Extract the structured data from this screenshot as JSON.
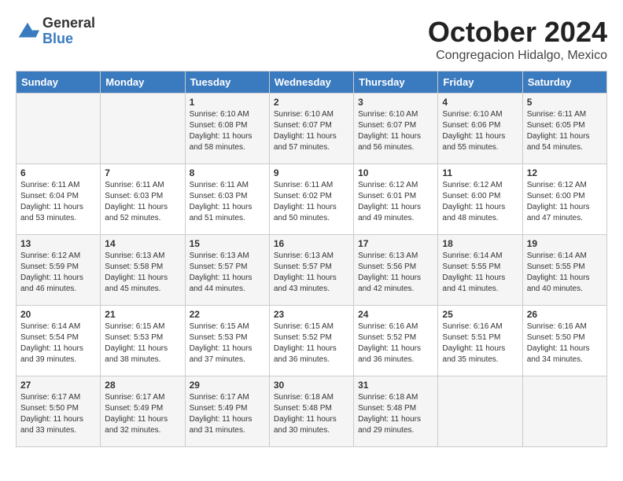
{
  "logo": {
    "general": "General",
    "blue": "Blue"
  },
  "title": "October 2024",
  "location": "Congregacion Hidalgo, Mexico",
  "headers": [
    "Sunday",
    "Monday",
    "Tuesday",
    "Wednesday",
    "Thursday",
    "Friday",
    "Saturday"
  ],
  "weeks": [
    [
      {
        "day": "",
        "sunrise": "",
        "sunset": "",
        "daylight": ""
      },
      {
        "day": "",
        "sunrise": "",
        "sunset": "",
        "daylight": ""
      },
      {
        "day": "1",
        "sunrise": "Sunrise: 6:10 AM",
        "sunset": "Sunset: 6:08 PM",
        "daylight": "Daylight: 11 hours and 58 minutes."
      },
      {
        "day": "2",
        "sunrise": "Sunrise: 6:10 AM",
        "sunset": "Sunset: 6:07 PM",
        "daylight": "Daylight: 11 hours and 57 minutes."
      },
      {
        "day": "3",
        "sunrise": "Sunrise: 6:10 AM",
        "sunset": "Sunset: 6:07 PM",
        "daylight": "Daylight: 11 hours and 56 minutes."
      },
      {
        "day": "4",
        "sunrise": "Sunrise: 6:10 AM",
        "sunset": "Sunset: 6:06 PM",
        "daylight": "Daylight: 11 hours and 55 minutes."
      },
      {
        "day": "5",
        "sunrise": "Sunrise: 6:11 AM",
        "sunset": "Sunset: 6:05 PM",
        "daylight": "Daylight: 11 hours and 54 minutes."
      }
    ],
    [
      {
        "day": "6",
        "sunrise": "Sunrise: 6:11 AM",
        "sunset": "Sunset: 6:04 PM",
        "daylight": "Daylight: 11 hours and 53 minutes."
      },
      {
        "day": "7",
        "sunrise": "Sunrise: 6:11 AM",
        "sunset": "Sunset: 6:03 PM",
        "daylight": "Daylight: 11 hours and 52 minutes."
      },
      {
        "day": "8",
        "sunrise": "Sunrise: 6:11 AM",
        "sunset": "Sunset: 6:03 PM",
        "daylight": "Daylight: 11 hours and 51 minutes."
      },
      {
        "day": "9",
        "sunrise": "Sunrise: 6:11 AM",
        "sunset": "Sunset: 6:02 PM",
        "daylight": "Daylight: 11 hours and 50 minutes."
      },
      {
        "day": "10",
        "sunrise": "Sunrise: 6:12 AM",
        "sunset": "Sunset: 6:01 PM",
        "daylight": "Daylight: 11 hours and 49 minutes."
      },
      {
        "day": "11",
        "sunrise": "Sunrise: 6:12 AM",
        "sunset": "Sunset: 6:00 PM",
        "daylight": "Daylight: 11 hours and 48 minutes."
      },
      {
        "day": "12",
        "sunrise": "Sunrise: 6:12 AM",
        "sunset": "Sunset: 6:00 PM",
        "daylight": "Daylight: 11 hours and 47 minutes."
      }
    ],
    [
      {
        "day": "13",
        "sunrise": "Sunrise: 6:12 AM",
        "sunset": "Sunset: 5:59 PM",
        "daylight": "Daylight: 11 hours and 46 minutes."
      },
      {
        "day": "14",
        "sunrise": "Sunrise: 6:13 AM",
        "sunset": "Sunset: 5:58 PM",
        "daylight": "Daylight: 11 hours and 45 minutes."
      },
      {
        "day": "15",
        "sunrise": "Sunrise: 6:13 AM",
        "sunset": "Sunset: 5:57 PM",
        "daylight": "Daylight: 11 hours and 44 minutes."
      },
      {
        "day": "16",
        "sunrise": "Sunrise: 6:13 AM",
        "sunset": "Sunset: 5:57 PM",
        "daylight": "Daylight: 11 hours and 43 minutes."
      },
      {
        "day": "17",
        "sunrise": "Sunrise: 6:13 AM",
        "sunset": "Sunset: 5:56 PM",
        "daylight": "Daylight: 11 hours and 42 minutes."
      },
      {
        "day": "18",
        "sunrise": "Sunrise: 6:14 AM",
        "sunset": "Sunset: 5:55 PM",
        "daylight": "Daylight: 11 hours and 41 minutes."
      },
      {
        "day": "19",
        "sunrise": "Sunrise: 6:14 AM",
        "sunset": "Sunset: 5:55 PM",
        "daylight": "Daylight: 11 hours and 40 minutes."
      }
    ],
    [
      {
        "day": "20",
        "sunrise": "Sunrise: 6:14 AM",
        "sunset": "Sunset: 5:54 PM",
        "daylight": "Daylight: 11 hours and 39 minutes."
      },
      {
        "day": "21",
        "sunrise": "Sunrise: 6:15 AM",
        "sunset": "Sunset: 5:53 PM",
        "daylight": "Daylight: 11 hours and 38 minutes."
      },
      {
        "day": "22",
        "sunrise": "Sunrise: 6:15 AM",
        "sunset": "Sunset: 5:53 PM",
        "daylight": "Daylight: 11 hours and 37 minutes."
      },
      {
        "day": "23",
        "sunrise": "Sunrise: 6:15 AM",
        "sunset": "Sunset: 5:52 PM",
        "daylight": "Daylight: 11 hours and 36 minutes."
      },
      {
        "day": "24",
        "sunrise": "Sunrise: 6:16 AM",
        "sunset": "Sunset: 5:52 PM",
        "daylight": "Daylight: 11 hours and 36 minutes."
      },
      {
        "day": "25",
        "sunrise": "Sunrise: 6:16 AM",
        "sunset": "Sunset: 5:51 PM",
        "daylight": "Daylight: 11 hours and 35 minutes."
      },
      {
        "day": "26",
        "sunrise": "Sunrise: 6:16 AM",
        "sunset": "Sunset: 5:50 PM",
        "daylight": "Daylight: 11 hours and 34 minutes."
      }
    ],
    [
      {
        "day": "27",
        "sunrise": "Sunrise: 6:17 AM",
        "sunset": "Sunset: 5:50 PM",
        "daylight": "Daylight: 11 hours and 33 minutes."
      },
      {
        "day": "28",
        "sunrise": "Sunrise: 6:17 AM",
        "sunset": "Sunset: 5:49 PM",
        "daylight": "Daylight: 11 hours and 32 minutes."
      },
      {
        "day": "29",
        "sunrise": "Sunrise: 6:17 AM",
        "sunset": "Sunset: 5:49 PM",
        "daylight": "Daylight: 11 hours and 31 minutes."
      },
      {
        "day": "30",
        "sunrise": "Sunrise: 6:18 AM",
        "sunset": "Sunset: 5:48 PM",
        "daylight": "Daylight: 11 hours and 30 minutes."
      },
      {
        "day": "31",
        "sunrise": "Sunrise: 6:18 AM",
        "sunset": "Sunset: 5:48 PM",
        "daylight": "Daylight: 11 hours and 29 minutes."
      },
      {
        "day": "",
        "sunrise": "",
        "sunset": "",
        "daylight": ""
      },
      {
        "day": "",
        "sunrise": "",
        "sunset": "",
        "daylight": ""
      }
    ]
  ]
}
